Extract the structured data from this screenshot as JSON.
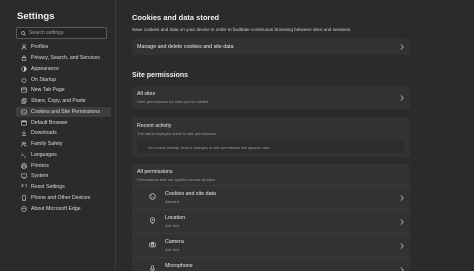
{
  "sidebar": {
    "title": "Settings",
    "search_placeholder": "Search settings",
    "items": [
      {
        "label": "Profiles",
        "icon": "profile-icon"
      },
      {
        "label": "Privacy, Search, and Services",
        "icon": "lock-icon"
      },
      {
        "label": "Appearance",
        "icon": "appearance-icon"
      },
      {
        "label": "On Startup",
        "icon": "power-icon"
      },
      {
        "label": "New Tab Page",
        "icon": "new-tab-icon"
      },
      {
        "label": "Share, Copy, and Paste",
        "icon": "share-icon"
      },
      {
        "label": "Cookies and Site Permissions",
        "icon": "cookies-icon"
      },
      {
        "label": "Default Browser",
        "icon": "browser-icon"
      },
      {
        "label": "Downloads",
        "icon": "download-icon"
      },
      {
        "label": "Family Safety",
        "icon": "family-icon"
      },
      {
        "label": "Languages",
        "icon": "languages-icon"
      },
      {
        "label": "Printers",
        "icon": "printer-icon"
      },
      {
        "label": "System",
        "icon": "system-icon"
      },
      {
        "label": "Reset Settings",
        "icon": "reset-icon"
      },
      {
        "label": "Phone and Other Devices",
        "icon": "phone-icon"
      },
      {
        "label": "About Microsoft Edge",
        "icon": "edge-icon"
      }
    ],
    "active_index": 6
  },
  "main": {
    "cookies_title": "Cookies and data stored",
    "cookies_desc": "Save cookies and data on your device in order to facilitate continuous browsing between sites and sessions",
    "manage_label": "Manage and delete cookies and site data",
    "site_permissions_title": "Site permissions",
    "all_sites": {
      "title": "All sites",
      "sub": "View permissions for sites you've visited"
    },
    "recent_activity": {
      "title": "Recent activity",
      "sub": "The latest changes made to site permissions",
      "empty": "No recent activity, recent changes to site permission will appear here."
    },
    "all_permissions": {
      "title": "All permissions",
      "sub": "Permissions that are applied across all sites"
    },
    "permissions": [
      {
        "title": "Cookies and site data",
        "sub": "Allowed",
        "icon": "cookie-icon"
      },
      {
        "title": "Location",
        "sub": "Ask first",
        "icon": "location-icon"
      },
      {
        "title": "Camera",
        "sub": "Ask first",
        "icon": "camera-icon"
      },
      {
        "title": "Microphone",
        "sub": "",
        "icon": "microphone-icon"
      }
    ]
  },
  "colors": {
    "background": "#2b2b2b",
    "card": "#323232",
    "active_nav": "#3d3d3d"
  }
}
